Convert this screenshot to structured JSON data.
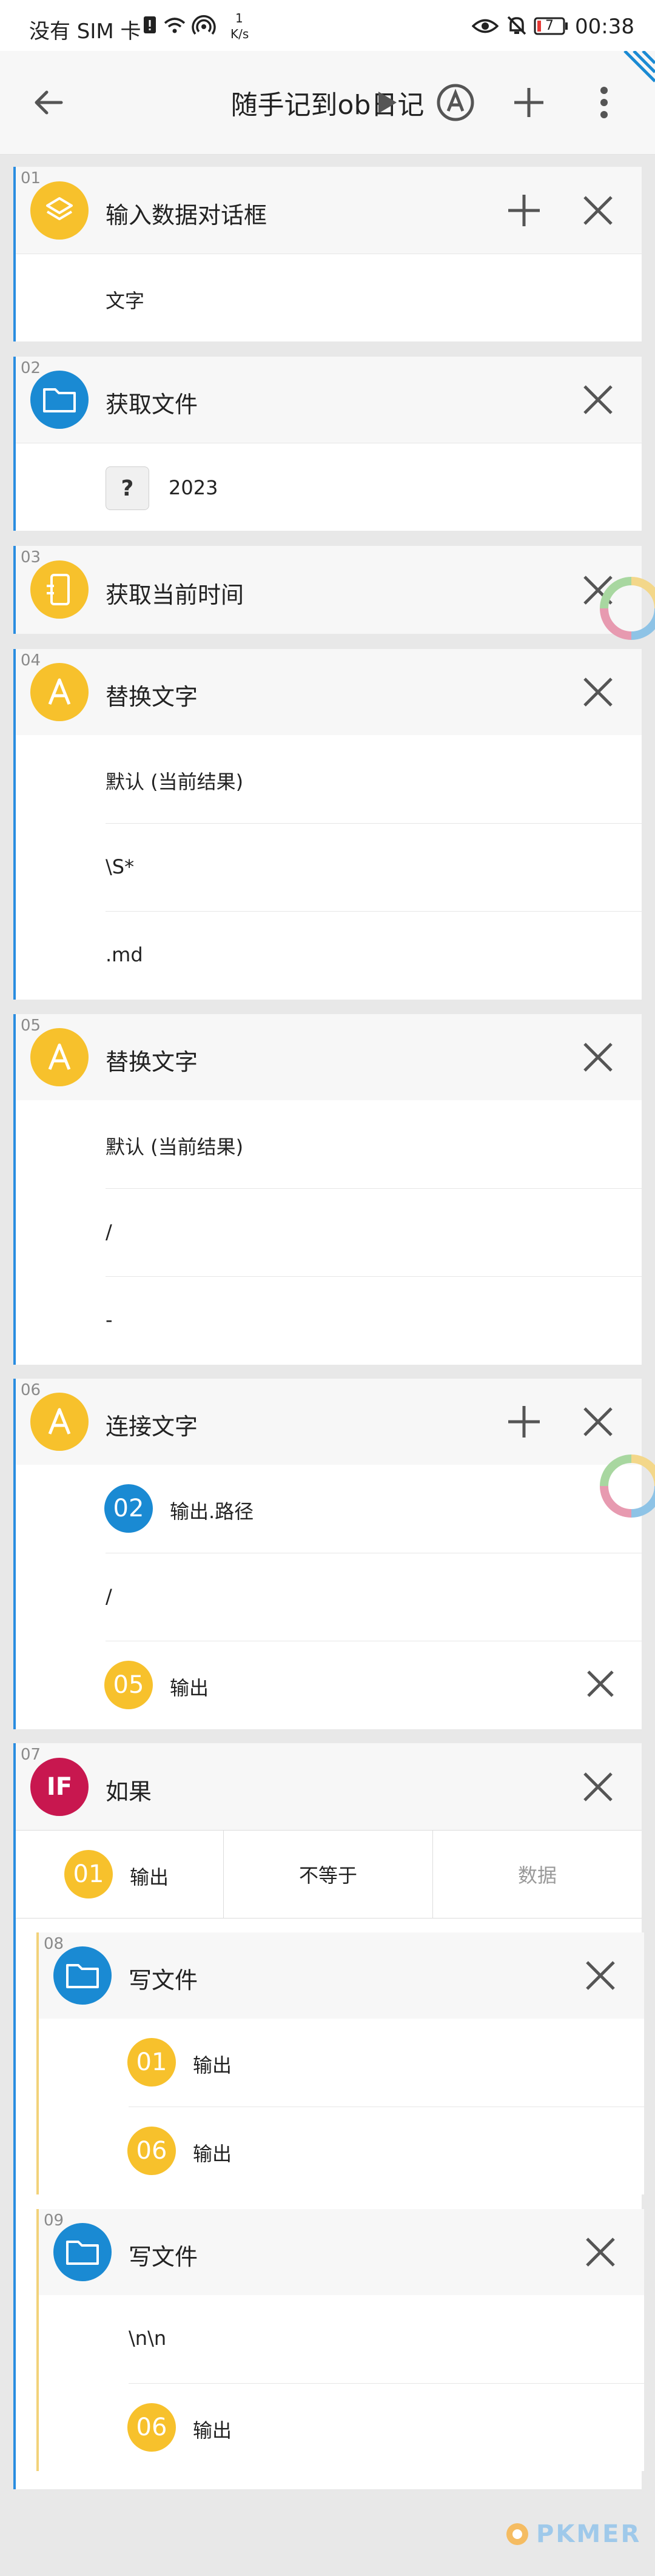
{
  "status_bar": {
    "carrier": "没有 SIM 卡",
    "net_speed_value": "1",
    "net_speed_unit": "K/s",
    "battery": "7",
    "time": "00:38"
  },
  "app_bar": {
    "title": "随手记到ob日记"
  },
  "blocks": [
    {
      "num": "01",
      "title": "输入数据对话框",
      "rows": [
        "文字"
      ]
    },
    {
      "num": "02",
      "title": "获取文件",
      "rows": [
        "2023"
      ]
    },
    {
      "num": "03",
      "title": "获取当前时间"
    },
    {
      "num": "04",
      "title": "替换文字",
      "rows": [
        "默认 (当前结果)",
        "\\S*",
        ".md"
      ]
    },
    {
      "num": "05",
      "title": "替换文字",
      "rows": [
        "默认 (当前结果)",
        "/",
        "-"
      ]
    },
    {
      "num": "06",
      "title": "连接文字",
      "rows": [
        {
          "ref": "02",
          "label": "输出.路径"
        },
        {
          "text": "/"
        },
        {
          "ref": "05",
          "label": "输出"
        }
      ]
    },
    {
      "num": "07",
      "title": "如果",
      "icon_text": "IF",
      "condition": {
        "ref": "01",
        "left_label": "输出",
        "operator": "不等于",
        "right_placeholder": "数据"
      }
    },
    {
      "num": "08",
      "title": "写文件",
      "rows": [
        {
          "ref": "01",
          "label": "输出"
        },
        {
          "ref": "06",
          "label": "输出"
        }
      ]
    },
    {
      "num": "09",
      "title": "写文件",
      "rows": [
        {
          "text": "\\n\\n"
        },
        {
          "ref": "06",
          "label": "输出"
        }
      ]
    }
  ],
  "watermark": "PKMER",
  "colors": {
    "yellow": "#f7c12c",
    "blue": "#1a8ad3",
    "crimson": "#c8174f",
    "accent_line": "#2a8de0",
    "nested_line": "#f2d27a"
  }
}
